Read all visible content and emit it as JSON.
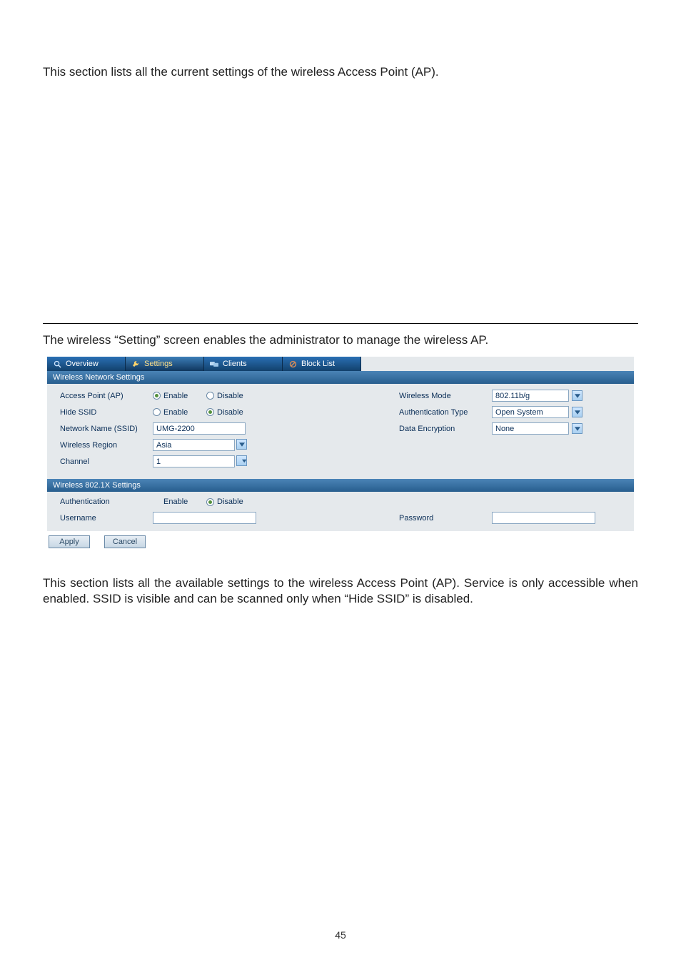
{
  "doc": {
    "intro_text": "This section lists all the current settings of the wireless Access Point (AP).",
    "mid_text": "The wireless “Setting” screen enables the administrator to manage the wireless AP.",
    "outro_text": "This section lists all the available settings to the wireless Access Point (AP). Service is only accessible when enabled. SSID is visible and can be scanned only when “Hide SSID” is disabled.",
    "page_number": "45"
  },
  "tabs": {
    "overview": "Overview",
    "settings": "Settings",
    "clients": "Clients",
    "blocklist": "Block List"
  },
  "section_titles": {
    "wns": "Wireless Network Settings",
    "w8021x": "Wireless 802.1X Settings"
  },
  "labels": {
    "ap": "Access Point (AP)",
    "hide_ssid": "Hide SSID",
    "ssid": "Network Name (SSID)",
    "region": "Wireless Region",
    "channel": "Channel",
    "wmode": "Wireless Mode",
    "authtype": "Authentication Type",
    "enc": "Data Encryption",
    "auth": "Authentication",
    "username": "Username",
    "password": "Password",
    "enable": "Enable",
    "disable": "Disable"
  },
  "values": {
    "ssid": "UMG-2200",
    "region": "Asia",
    "channel": "1",
    "wmode": "802.11b/g",
    "authtype": "Open System",
    "enc": "None",
    "username": "",
    "password": ""
  },
  "buttons": {
    "apply": "Apply",
    "cancel": "Cancel"
  },
  "chart_data": {
    "type": "table",
    "title": "Wireless Network Settings",
    "rows": [
      {
        "field": "Access Point (AP)",
        "value": "Enable",
        "options": [
          "Enable",
          "Disable"
        ]
      },
      {
        "field": "Hide SSID",
        "value": "Disable",
        "options": [
          "Enable",
          "Disable"
        ]
      },
      {
        "field": "Network Name (SSID)",
        "value": "UMG-2200"
      },
      {
        "field": "Wireless Region",
        "value": "Asia"
      },
      {
        "field": "Channel",
        "value": "1"
      },
      {
        "field": "Wireless Mode",
        "value": "802.11b/g"
      },
      {
        "field": "Authentication Type",
        "value": "Open System"
      },
      {
        "field": "Data Encryption",
        "value": "None"
      },
      {
        "field": "Authentication (802.1X)",
        "value": "Disable",
        "options": [
          "Enable",
          "Disable"
        ]
      },
      {
        "field": "Username",
        "value": ""
      },
      {
        "field": "Password",
        "value": ""
      }
    ]
  }
}
